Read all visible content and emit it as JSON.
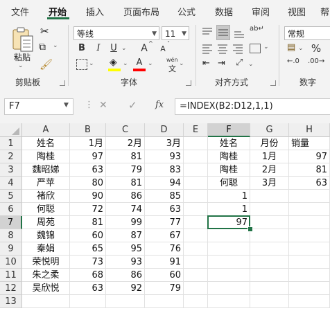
{
  "menu": [
    "文件",
    "开始",
    "插入",
    "页面布局",
    "公式",
    "数据",
    "审阅",
    "视图",
    "帮"
  ],
  "active_menu": "开始",
  "ribbon": {
    "clipboard": {
      "paste_label": "粘贴",
      "group_label": "剪贴板"
    },
    "font": {
      "font_name": "等线",
      "font_size": "11",
      "bold": "B",
      "italic": "I",
      "underline": "U",
      "grow": "A",
      "shrink": "A",
      "phonetic": "wén",
      "font_color_letter": "A",
      "group_label": "字体"
    },
    "alignment": {
      "group_label": "对齐方式"
    },
    "number": {
      "format": "常规",
      "percent": "%",
      "group_label": "数字"
    }
  },
  "formula_bar": {
    "name_box": "F7",
    "fx": "fx",
    "formula": "=INDEX(B2:D12,1,1)"
  },
  "sheet": {
    "columns": [
      "A",
      "B",
      "C",
      "D",
      "E",
      "F",
      "G",
      "H"
    ],
    "selected_cell": "F7",
    "rows": [
      [
        "姓名",
        "1月",
        "2月",
        "3月",
        "",
        "姓名",
        "月份",
        "销量"
      ],
      [
        "陶桂",
        "97",
        "81",
        "93",
        "",
        "陶桂",
        "1月",
        "97"
      ],
      [
        "魏昭娣",
        "63",
        "79",
        "83",
        "",
        "陶桂",
        "2月",
        "81"
      ],
      [
        "严苹",
        "80",
        "81",
        "94",
        "",
        "何聪",
        "3月",
        "63"
      ],
      [
        "褚欣",
        "90",
        "86",
        "85",
        "",
        "1",
        "",
        ""
      ],
      [
        "何聪",
        "72",
        "74",
        "63",
        "",
        "1",
        "",
        ""
      ],
      [
        "周苑",
        "81",
        "99",
        "77",
        "",
        "97",
        "",
        ""
      ],
      [
        "魏锦",
        "60",
        "87",
        "67",
        "",
        "",
        "",
        ""
      ],
      [
        "秦娟",
        "65",
        "95",
        "76",
        "",
        "",
        "",
        ""
      ],
      [
        "荣悦明",
        "73",
        "93",
        "91",
        "",
        "",
        "",
        ""
      ],
      [
        "朱之柔",
        "68",
        "86",
        "60",
        "",
        "",
        "",
        ""
      ],
      [
        "吴欣悦",
        "63",
        "92",
        "79",
        "",
        "",
        "",
        ""
      ],
      [
        "",
        "",
        "",
        "",
        "",
        "",
        "",
        ""
      ]
    ],
    "row_numbers": [
      "1",
      "2",
      "3",
      "4",
      "5",
      "6",
      "7",
      "8",
      "9",
      "10",
      "11",
      "12",
      "13"
    ],
    "colors": {
      "accent": "#217346",
      "header_bg": "#efefef",
      "ribbon_bg": "#f3f3f3"
    }
  }
}
